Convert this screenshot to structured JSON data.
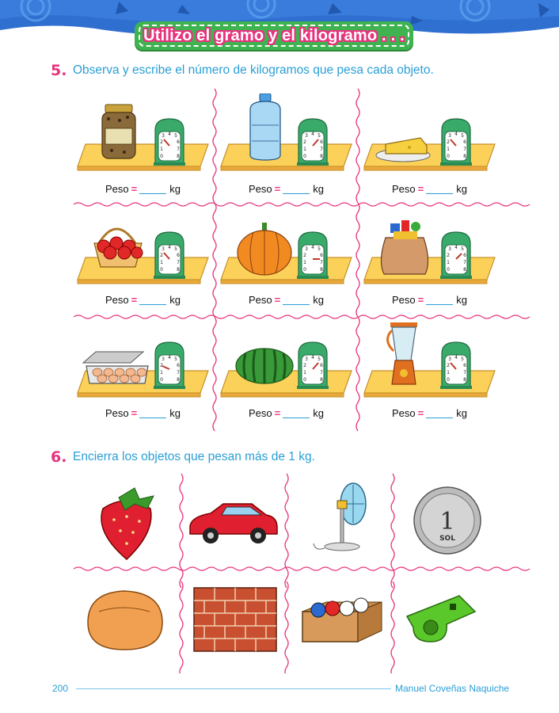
{
  "header": {
    "title": "Utilizo el gramo y el kilogramo . . .",
    "band_color": "#2f6fd0",
    "accent_pink": "#e8337e",
    "accent_green": "#3fb34f"
  },
  "exercise5": {
    "number": "5.",
    "instruction": "Observa y escribe el número de kilogramos que pesa cada objeto.",
    "items": [
      {
        "object": "jar-icon",
        "peso_label": "Peso",
        "equals": "=",
        "unit": "kg"
      },
      {
        "object": "water-bottle-icon",
        "peso_label": "Peso",
        "equals": "=",
        "unit": "kg"
      },
      {
        "object": "cheese-plate-icon",
        "peso_label": "Peso",
        "equals": "=",
        "unit": "kg"
      },
      {
        "object": "apple-basket-icon",
        "peso_label": "Peso",
        "equals": "=",
        "unit": "kg"
      },
      {
        "object": "pumpkin-icon",
        "peso_label": "Peso",
        "equals": "=",
        "unit": "kg"
      },
      {
        "object": "toy-sack-icon",
        "peso_label": "Peso",
        "equals": "=",
        "unit": "kg"
      },
      {
        "object": "egg-carton-icon",
        "peso_label": "Peso",
        "equals": "=",
        "unit": "kg"
      },
      {
        "object": "watermelon-icon",
        "peso_label": "Peso",
        "equals": "=",
        "unit": "kg"
      },
      {
        "object": "blender-icon",
        "peso_label": "Peso",
        "equals": "=",
        "unit": "kg"
      }
    ],
    "scale_ticks": [
      "0",
      "1",
      "2",
      "3",
      "4",
      "5",
      "6",
      "7",
      "8"
    ]
  },
  "exercise6": {
    "number": "6.",
    "instruction": "Encierra los objetos que pesan más de 1 kg.",
    "items": [
      "strawberry-icon",
      "toy-car-icon",
      "electric-fan-icon",
      "coin-icon",
      "bread-icon",
      "brick-wall-icon",
      "ball-box-icon",
      "whistle-icon"
    ],
    "coin_value": "1",
    "coin_unit": "SOL"
  },
  "footer": {
    "page_number": "200",
    "author": "Manuel Coveñas Naquiche"
  }
}
